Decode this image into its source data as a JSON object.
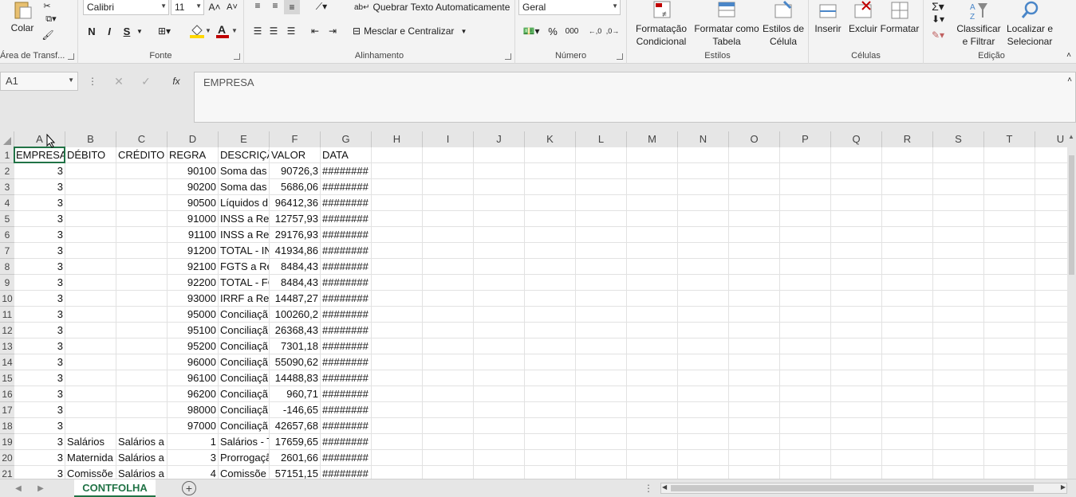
{
  "ribbon": {
    "clipboard": {
      "paste_label": "Colar",
      "group_label": "Área de Transf..."
    },
    "font": {
      "name": "Calibri",
      "size": "11",
      "bold": "N",
      "italic": "I",
      "underline": "S",
      "group_label": "Fonte"
    },
    "alignment": {
      "wrap_text": "Quebrar Texto Automaticamente",
      "merge_center": "Mesclar e Centralizar",
      "group_label": "Alinhamento"
    },
    "number": {
      "format": "Geral",
      "percent": "%",
      "thousands": "000",
      "group_label": "Número"
    },
    "styles": {
      "conditional": "Formatação Condicional",
      "format_table": "Formatar como Tabela",
      "cell_styles": "Estilos de Célula",
      "group_label": "Estilos"
    },
    "cells": {
      "insert": "Inserir",
      "delete": "Excluir",
      "format": "Formatar",
      "group_label": "Células"
    },
    "editing": {
      "sort_filter": "Classificar e Filtrar",
      "find_select": "Localizar e Selecionar",
      "group_label": "Edição"
    }
  },
  "formula_bar": {
    "name_box": "A1",
    "fx": "fx",
    "content": "EMPRESA"
  },
  "columns": [
    "A",
    "B",
    "C",
    "D",
    "E",
    "F",
    "G",
    "H",
    "I",
    "J",
    "K",
    "L",
    "M",
    "N",
    "O",
    "P",
    "Q",
    "R",
    "S",
    "T",
    "U"
  ],
  "rows": [
    [
      "EMPRESA",
      "DÉBITO",
      "CRÉDITO",
      "REGRA",
      "DESCRIÇÃ",
      "VALOR",
      "DATA"
    ],
    [
      "3",
      "",
      "",
      "90100",
      "Soma das",
      "90726,3",
      "########"
    ],
    [
      "3",
      "",
      "",
      "90200",
      "Soma das",
      "5686,06",
      "########"
    ],
    [
      "3",
      "",
      "",
      "90500",
      "Líquidos d",
      "96412,36",
      "########"
    ],
    [
      "3",
      "",
      "",
      "91000",
      "INSS a Rec",
      "12757,93",
      "########"
    ],
    [
      "3",
      "",
      "",
      "91100",
      "INSS a Rec",
      "29176,93",
      "########"
    ],
    [
      "3",
      "",
      "",
      "91200",
      "TOTAL - IN",
      "41934,86",
      "########"
    ],
    [
      "3",
      "",
      "",
      "92100",
      "FGTS a Re",
      "8484,43",
      "########"
    ],
    [
      "3",
      "",
      "",
      "92200",
      "TOTAL - FC",
      "8484,43",
      "########"
    ],
    [
      "3",
      "",
      "",
      "93000",
      "IRRF a Rec",
      "14487,27",
      "########"
    ],
    [
      "3",
      "",
      "",
      "95000",
      "Conciliaçã",
      "100260,2",
      "########"
    ],
    [
      "3",
      "",
      "",
      "95100",
      "Conciliaçã",
      "26368,43",
      "########"
    ],
    [
      "3",
      "",
      "",
      "95200",
      "Conciliaçã",
      "7301,18",
      "########"
    ],
    [
      "3",
      "",
      "",
      "96000",
      "Conciliaçã",
      "55090,62",
      "########"
    ],
    [
      "3",
      "",
      "",
      "96100",
      "Conciliaçã",
      "14488,83",
      "########"
    ],
    [
      "3",
      "",
      "",
      "96200",
      "Conciliaçã",
      "960,71",
      "########"
    ],
    [
      "3",
      "",
      "",
      "98000",
      "Conciliaçã",
      "-146,65",
      "########"
    ],
    [
      "3",
      "",
      "",
      "97000",
      "Conciliaçã",
      "42657,68",
      "########"
    ],
    [
      "3",
      "Salários",
      "Salários a",
      "1",
      "Salários - T",
      "17659,65",
      "########"
    ],
    [
      "3",
      "Maternida",
      "Salários a",
      "3",
      "Prorrogaçã",
      "2601,66",
      "########"
    ],
    [
      "3",
      "Comissõe",
      "Salários a",
      "4",
      "Comissõe",
      "57151,15",
      "########"
    ]
  ],
  "sheet_tab": "CONTFOLHA",
  "colors": {
    "accent": "#217346",
    "font_color": "#c00000",
    "highlight": "#ffd700"
  }
}
